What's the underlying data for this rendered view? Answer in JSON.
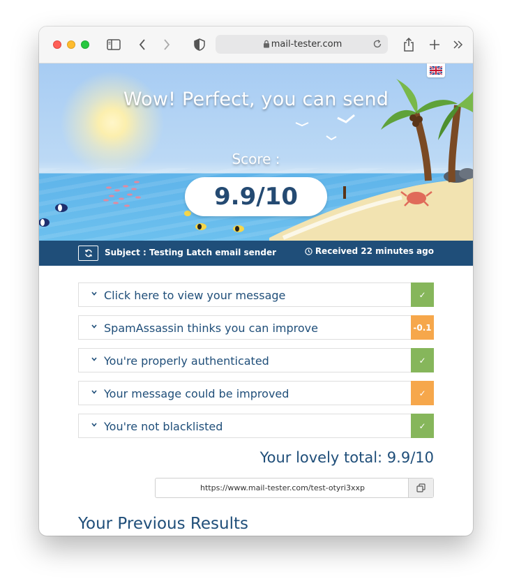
{
  "browser": {
    "url": "mail-tester.com",
    "icons": [
      "sidebar-icon",
      "back-icon",
      "forward-icon",
      "shield-icon",
      "lock-icon",
      "reload-icon",
      "share-icon",
      "new-tab-icon",
      "more-icon"
    ]
  },
  "hero": {
    "title": "Wow! Perfect, you can send",
    "score_label": "Score :",
    "score": "9.9/10",
    "language_icon": "uk-flag-icon"
  },
  "subject_bar": {
    "subject": "Subject : Testing Latch email sender",
    "received": "Received 22 minutes ago"
  },
  "results": [
    {
      "label": "Click here to view your message",
      "status": "✓",
      "color": "#86b65b"
    },
    {
      "label": "SpamAssassin thinks you can improve",
      "status": "-0.1",
      "color": "#f6a74b"
    },
    {
      "label": "You're properly authenticated",
      "status": "✓",
      "color": "#86b65b"
    },
    {
      "label": "Your message could be improved",
      "status": "✓",
      "color": "#f6a74b"
    },
    {
      "label": "You're not blacklisted",
      "status": "✓",
      "color": "#86b65b"
    }
  ],
  "total": "Your lovely total: 9.9/10",
  "share_link": "https://www.mail-tester.com/test-otyri3xxp",
  "previous_title": "Your Previous Results",
  "colors": {
    "brand": "#1f4e79",
    "good": "#86b65b",
    "warn": "#f6a74b"
  }
}
